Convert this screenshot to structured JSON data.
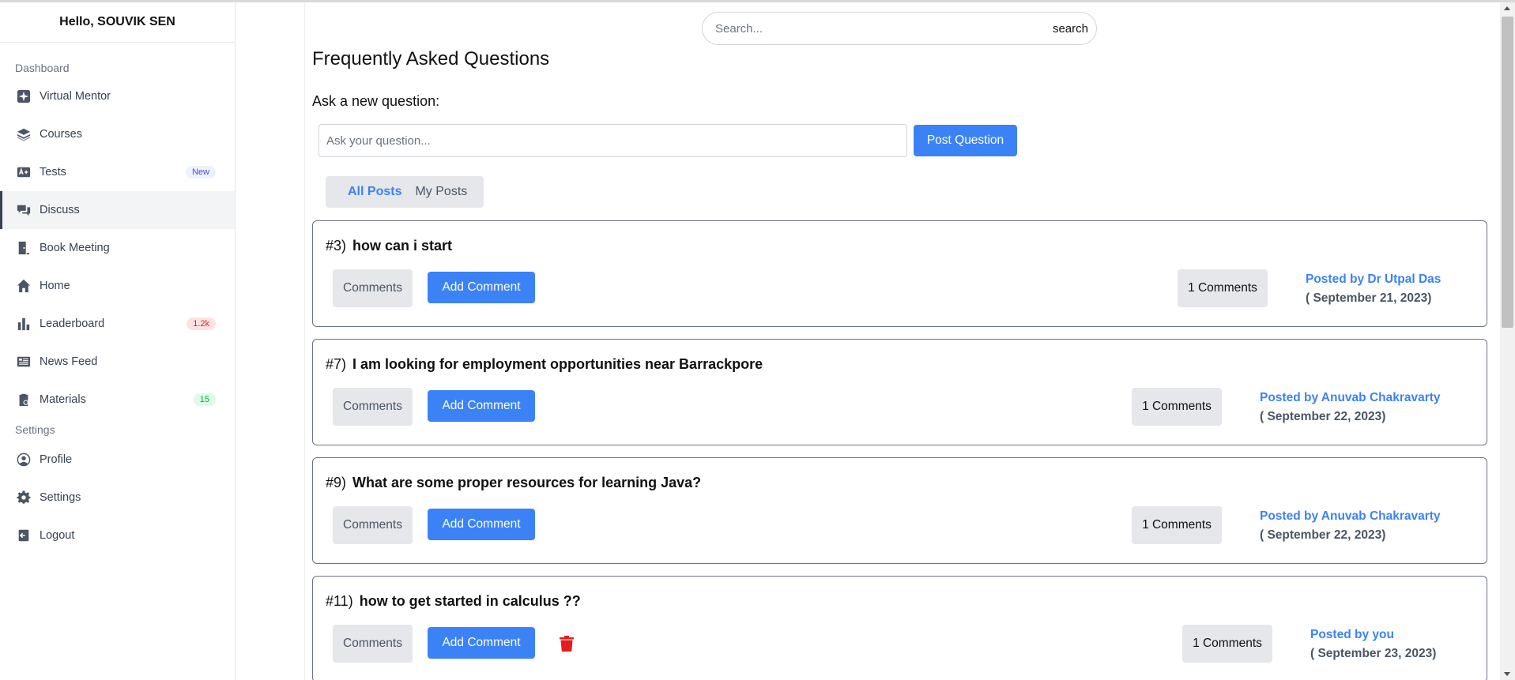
{
  "sidebar": {
    "greeting": "Hello, SOUVIK SEN",
    "section_dashboard": "Dashboard",
    "section_settings": "Settings",
    "items": [
      {
        "label": "Virtual Mentor",
        "icon": "sparkle-icon"
      },
      {
        "label": "Courses",
        "icon": "layers-icon"
      },
      {
        "label": "Tests",
        "icon": "test-icon",
        "badge": "New",
        "badge_color": "#4f46e5"
      },
      {
        "label": "Discuss",
        "icon": "chat-icon",
        "active": true
      },
      {
        "label": "Book Meeting",
        "icon": "door-icon"
      },
      {
        "label": "Home",
        "icon": "home-icon"
      },
      {
        "label": "Leaderboard",
        "icon": "bar-chart-icon",
        "badge": "1.2k",
        "badge_color": "#dc2626"
      },
      {
        "label": "News Feed",
        "icon": "newspaper-icon"
      },
      {
        "label": "Materials",
        "icon": "clipboard-icon",
        "badge": "15",
        "badge_color": "#16a34a"
      }
    ],
    "settings_items": [
      {
        "label": "Profile",
        "icon": "user-circle-icon"
      },
      {
        "label": "Settings",
        "icon": "gear-icon"
      },
      {
        "label": "Logout",
        "icon": "logout-icon"
      }
    ]
  },
  "search": {
    "placeholder": "Search...",
    "button": "search"
  },
  "main": {
    "title": "Frequently Asked Questions",
    "ask_label": "Ask a new question:",
    "ask_placeholder": "Ask your question...",
    "post_button": "Post Question",
    "tabs": [
      {
        "label": "All Posts",
        "active": true
      },
      {
        "label": "My Posts"
      }
    ],
    "comments_button": "Comments",
    "add_comment_button": "Add Comment",
    "questions": [
      {
        "number": "#3)",
        "text": "how can i start",
        "comments": "1 Comments",
        "posted_by": "Posted by Dr Utpal Das",
        "date": "( September 21, 2023)",
        "deletable": false
      },
      {
        "number": "#7)",
        "text": "I am looking for employment opportunities near Barrackpore",
        "comments": "1 Comments",
        "posted_by": "Posted by Anuvab Chakravarty",
        "date": "( September 22, 2023)",
        "deletable": false
      },
      {
        "number": "#9)",
        "text": "What are some proper resources for learning Java?",
        "comments": "1 Comments",
        "posted_by": "Posted by Anuvab Chakravarty",
        "date": "( September 22, 2023)",
        "deletable": false
      },
      {
        "number": "#11)",
        "text": "how to get started in calculus ??",
        "comments": "1 Comments",
        "posted_by": "Posted by you",
        "date": "( September 23, 2023)",
        "deletable": true
      }
    ]
  },
  "colors": {
    "accent": "#3b82f6",
    "danger": "#e11d1d"
  }
}
